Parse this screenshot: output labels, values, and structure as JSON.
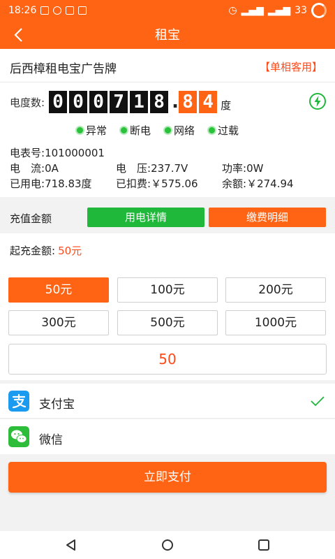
{
  "status_bar": {
    "time": "18:26",
    "battery": "33"
  },
  "nav": {
    "title": "租宝"
  },
  "shop": {
    "name": "后西樟租电宝广告牌",
    "tag": "【单相客用】"
  },
  "meter": {
    "label": "电度数:",
    "integer_digits": [
      "0",
      "0",
      "0",
      "7",
      "1",
      "8"
    ],
    "dot": ".",
    "decimal_digits": [
      "8",
      "4"
    ],
    "unit": "度"
  },
  "status_legend": [
    "异常",
    "断电",
    "网络",
    "过载"
  ],
  "info": {
    "meter_no_label": "电表号:",
    "meter_no": "101000001",
    "current_label": "电　流:",
    "current": "0A",
    "voltage_label": "电　压:",
    "voltage": "237.7V",
    "power_label": "功率:",
    "power": "0W",
    "used_label": "已用电:",
    "used": "718.83度",
    "deducted_label": "已扣费:",
    "deducted": "￥575.06",
    "balance_label": "余额:",
    "balance": "￥274.94"
  },
  "recharge": {
    "label": "充值金额",
    "detail_button": "用电详情",
    "bill_button": "缴费明细",
    "min_label": "起充金额:",
    "min_value": "50元",
    "amounts": [
      "50元",
      "100元",
      "200元",
      "300元",
      "500元",
      "1000元"
    ],
    "selected_index": 0,
    "input_value": "50"
  },
  "payment": {
    "methods": [
      {
        "label": "支付宝",
        "icon": "alipay-icon",
        "selected": true
      },
      {
        "label": "微信",
        "icon": "wechat-icon",
        "selected": false
      }
    ],
    "pay_button": "立即支付"
  },
  "colors": {
    "brand": "#ff6414",
    "green": "#1fb83a",
    "accent_text": "#ff4a1a"
  }
}
